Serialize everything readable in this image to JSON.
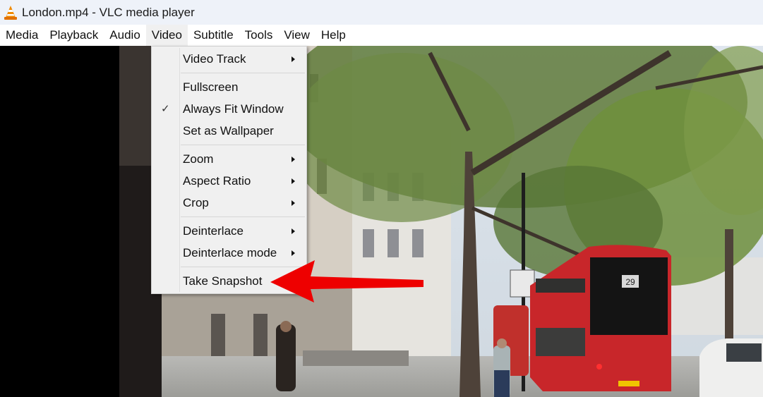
{
  "window": {
    "title": "London.mp4 - VLC media player",
    "app_icon": "vlc-cone-icon"
  },
  "menubar": {
    "items": [
      {
        "label": "Media"
      },
      {
        "label": "Playback"
      },
      {
        "label": "Audio"
      },
      {
        "label": "Video",
        "active": true
      },
      {
        "label": "Subtitle"
      },
      {
        "label": "Tools"
      },
      {
        "label": "View"
      },
      {
        "label": "Help"
      }
    ]
  },
  "video_menu": {
    "items": [
      {
        "label": "Video Track",
        "submenu": true,
        "checked": false
      },
      {
        "label": "Fullscreen",
        "submenu": false,
        "checked": false
      },
      {
        "label": "Always Fit Window",
        "submenu": false,
        "checked": true
      },
      {
        "label": "Set as Wallpaper",
        "submenu": false,
        "checked": false
      },
      {
        "label": "Zoom",
        "submenu": true,
        "checked": false
      },
      {
        "label": "Aspect Ratio",
        "submenu": true,
        "checked": false
      },
      {
        "label": "Crop",
        "submenu": true,
        "checked": false
      },
      {
        "label": "Deinterlace",
        "submenu": true,
        "checked": false
      },
      {
        "label": "Deinterlace mode",
        "submenu": true,
        "checked": false
      },
      {
        "label": "Take Snapshot",
        "submenu": false,
        "checked": false
      }
    ],
    "check_glyph": "✓"
  },
  "video_frame": {
    "description": "London street scene with trees, buildings and red double-decker buses",
    "bus_route_number": "29"
  },
  "annotation": {
    "type": "red-arrow",
    "color": "#ee0000",
    "points_to": "Take Snapshot"
  }
}
